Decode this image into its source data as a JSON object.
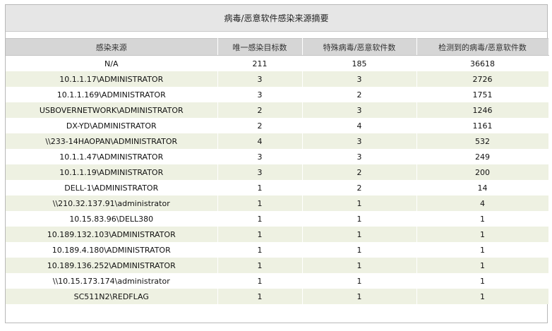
{
  "report": {
    "title": "病毒/恶意软件感染来源摘要",
    "columns": [
      "感染来源",
      "唯一感染目标数",
      "特殊病毒/恶意软件数",
      "检测到的病毒/恶意软件数"
    ],
    "rows": [
      [
        "N/A",
        "211",
        "185",
        "36618"
      ],
      [
        "10.1.1.17\\ADMINISTRATOR",
        "3",
        "3",
        "2726"
      ],
      [
        "10.1.1.169\\ADMINISTRATOR",
        "3",
        "2",
        "1751"
      ],
      [
        "USBOVERNETWORK\\ADMINISTRATOR",
        "2",
        "3",
        "1246"
      ],
      [
        "DX-YD\\ADMINISTRATOR",
        "2",
        "4",
        "1161"
      ],
      [
        "\\\\233-14HAOPAN\\ADMINISTRATOR",
        "4",
        "3",
        "532"
      ],
      [
        "10.1.1.47\\ADMINISTRATOR",
        "3",
        "3",
        "249"
      ],
      [
        "10.1.1.19\\ADMINISTRATOR",
        "3",
        "2",
        "200"
      ],
      [
        "DELL-1\\ADMINISTRATOR",
        "1",
        "2",
        "14"
      ],
      [
        "\\\\210.32.137.91\\administrator",
        "1",
        "1",
        "4"
      ],
      [
        "10.15.83.96\\DELL380",
        "1",
        "1",
        "1"
      ],
      [
        "10.189.132.103\\ADMINISTRATOR",
        "1",
        "1",
        "1"
      ],
      [
        "10.189.4.180\\ADMINISTRATOR",
        "1",
        "1",
        "1"
      ],
      [
        "10.189.136.252\\ADMINISTRATOR",
        "1",
        "1",
        "1"
      ],
      [
        "\\\\10.15.173.174\\administrator",
        "1",
        "1",
        "1"
      ],
      [
        "SC511N2\\REDFLAG",
        "1",
        "1",
        "1"
      ]
    ]
  },
  "colors": {
    "header_bg": "#d6d6d6",
    "title_bg": "#e6e6e6",
    "stripe": "#eef1e2"
  }
}
